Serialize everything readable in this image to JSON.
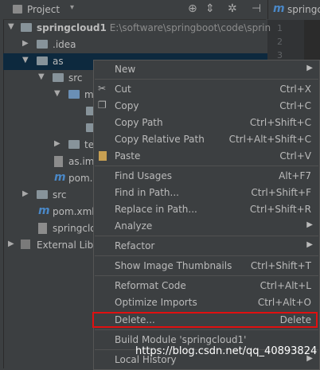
{
  "project_header": {
    "title": "Project"
  },
  "editor": {
    "tab_label": "springc",
    "line_numbers": [
      "1",
      "2",
      "3"
    ]
  },
  "tree": {
    "rows": [
      {
        "label": "springcloud1",
        "path": "E:\\software\\springboot\\code\\sprin"
      },
      {
        "label": ".idea"
      },
      {
        "label": "as"
      },
      {
        "label": "src"
      },
      {
        "label": "m"
      },
      {
        "label": ""
      },
      {
        "label": ""
      },
      {
        "label": "te"
      },
      {
        "label": "as.iml"
      },
      {
        "label": "pom.x"
      },
      {
        "label": "src"
      },
      {
        "label": "pom.xml"
      },
      {
        "label": "springclo"
      },
      {
        "label": "External Libr"
      }
    ]
  },
  "context_menu": {
    "items": [
      {
        "label": "New",
        "shortcut": "",
        "submenu": true
      },
      {
        "label": "Cut",
        "shortcut": "Ctrl+X",
        "icon": "cut-icon"
      },
      {
        "label": "Copy",
        "shortcut": "Ctrl+C",
        "icon": "copy-icon"
      },
      {
        "label": "Copy Path",
        "shortcut": "Ctrl+Shift+C"
      },
      {
        "label": "Copy Relative Path",
        "shortcut": "Ctrl+Alt+Shift+C"
      },
      {
        "label": "Paste",
        "shortcut": "Ctrl+V",
        "icon": "paste-icon"
      },
      {
        "label": "Find Usages",
        "shortcut": "Alt+F7"
      },
      {
        "label": "Find in Path...",
        "shortcut": "Ctrl+Shift+F"
      },
      {
        "label": "Replace in Path...",
        "shortcut": "Ctrl+Shift+R"
      },
      {
        "label": "Analyze",
        "shortcut": "",
        "submenu": true
      },
      {
        "label": "Refactor",
        "shortcut": "",
        "submenu": true
      },
      {
        "label": "Show Image Thumbnails",
        "shortcut": "Ctrl+Shift+T"
      },
      {
        "label": "Reformat Code",
        "shortcut": "Ctrl+Alt+L"
      },
      {
        "label": "Optimize Imports",
        "shortcut": "Ctrl+Alt+O"
      },
      {
        "label": "Delete...",
        "shortcut": "Delete"
      },
      {
        "label": "Build Module 'springcloud1'",
        "shortcut": ""
      },
      {
        "label": "Local History",
        "shortcut": "",
        "submenu": true
      }
    ]
  },
  "watermark": "https://blog.csdn.net/qq_40893824",
  "colors": {
    "highlight_border": "#e01010",
    "selection": "#0d293e",
    "background": "#3c3f41"
  }
}
